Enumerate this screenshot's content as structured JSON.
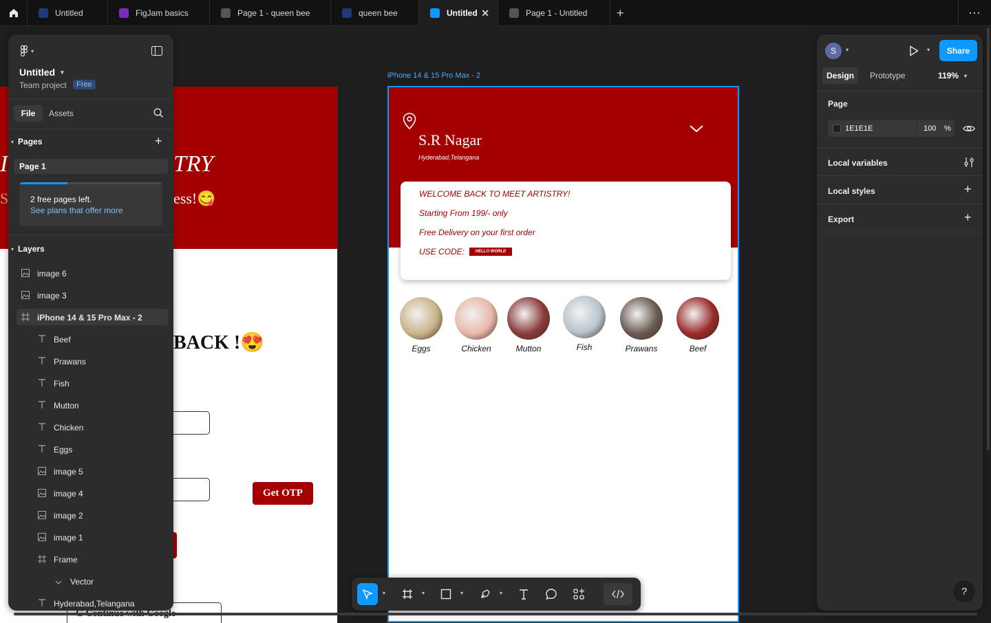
{
  "tabs": [
    {
      "label": "Untitled",
      "color": "#1f3a7a"
    },
    {
      "label": "FigJam basics",
      "color": "#7b2cbf"
    },
    {
      "label": "Page 1 - queen bee",
      "color": "#555555"
    },
    {
      "label": "queen bee",
      "color": "#1f3a7a"
    },
    {
      "label": "Untitled",
      "color": "#0d99ff",
      "active": true
    },
    {
      "label": "Page 1 - Untitled",
      "color": "#555555"
    }
  ],
  "leftpanel": {
    "file_name": "Untitled",
    "team": "Team project",
    "plan_badge": "Free",
    "tab_file": "File",
    "tab_assets": "Assets",
    "pages_title": "Pages",
    "current_page": "Page 1",
    "free_pages_msg": "2 free pages left.",
    "plans_link": "See plans that offer more",
    "layers_title": "Layers",
    "layers": [
      {
        "name": "image 6",
        "icon": "image-icon",
        "indent": 0
      },
      {
        "name": "image 3",
        "icon": "image-icon",
        "indent": 0
      },
      {
        "name": "iPhone 14 & 15 Pro Max - 2",
        "icon": "frame-icon",
        "indent": 0,
        "selected": true
      },
      {
        "name": "Beef",
        "icon": "text-icon",
        "indent": 1
      },
      {
        "name": "Prawans",
        "icon": "text-icon",
        "indent": 1
      },
      {
        "name": "Fish",
        "icon": "text-icon",
        "indent": 1
      },
      {
        "name": "Mutton",
        "icon": "text-icon",
        "indent": 1
      },
      {
        "name": "Chicken",
        "icon": "text-icon",
        "indent": 1
      },
      {
        "name": "Eggs",
        "icon": "text-icon",
        "indent": 1
      },
      {
        "name": "image 5",
        "icon": "image-icon",
        "indent": 1
      },
      {
        "name": "image 4",
        "icon": "image-icon",
        "indent": 1
      },
      {
        "name": "image 2",
        "icon": "image-icon",
        "indent": 1
      },
      {
        "name": "image 1",
        "icon": "image-icon",
        "indent": 1
      },
      {
        "name": "Frame",
        "icon": "frame-icon",
        "indent": 1
      },
      {
        "name": "Vector",
        "icon": "chevron-down-icon",
        "indent": 2
      },
      {
        "name": "Hyderabad,Telangana",
        "icon": "text-icon",
        "indent": 1
      }
    ]
  },
  "leftframe": {
    "title_fragment": "TRY",
    "subtitle_fragment": "ess!😋",
    "welcome_fragment": "BACK !😍",
    "otp_button": "Get OTP",
    "google_button": "Continue with Google",
    "left_edge_char": "S",
    "left_title_char": "I"
  },
  "phone": {
    "frame_label": "iPhone 14 & 15 Pro Max - 2",
    "location_name": "S.R Nagar",
    "location_sub": "Hyderabad,Telangana",
    "promo_lines": [
      "WELCOME BACK TO MEET ARTISTRY!",
      "Starting From 199/- only",
      "Free Delivery on your first order",
      "USE CODE:"
    ],
    "code": "HELLO WORLD",
    "categories": [
      {
        "label": "Eggs",
        "color": "#c9b48a"
      },
      {
        "label": "Chicken",
        "color": "#e8b8a8"
      },
      {
        "label": "Mutton",
        "color": "#8a3a3a"
      },
      {
        "label": "Fish",
        "color": "#b8c4cc"
      },
      {
        "label": "Prawans",
        "color": "#6a5a50"
      },
      {
        "label": "Beef",
        "color": "#9a2a2a"
      }
    ]
  },
  "rightpanel": {
    "avatar_initial": "S",
    "share_label": "Share",
    "tab_design": "Design",
    "tab_prototype": "Prototype",
    "zoom": "119%",
    "page_title": "Page",
    "bg_hex": "1E1E1E",
    "bg_opacity": "100",
    "percent": "%",
    "local_variables": "Local variables",
    "local_styles": "Local styles",
    "export": "Export",
    "help": "?"
  },
  "colors": {
    "accent": "#0d99ff",
    "brand_red": "#a50000",
    "panel": "#2c2c2c",
    "canvas": "#1e1e1e"
  }
}
